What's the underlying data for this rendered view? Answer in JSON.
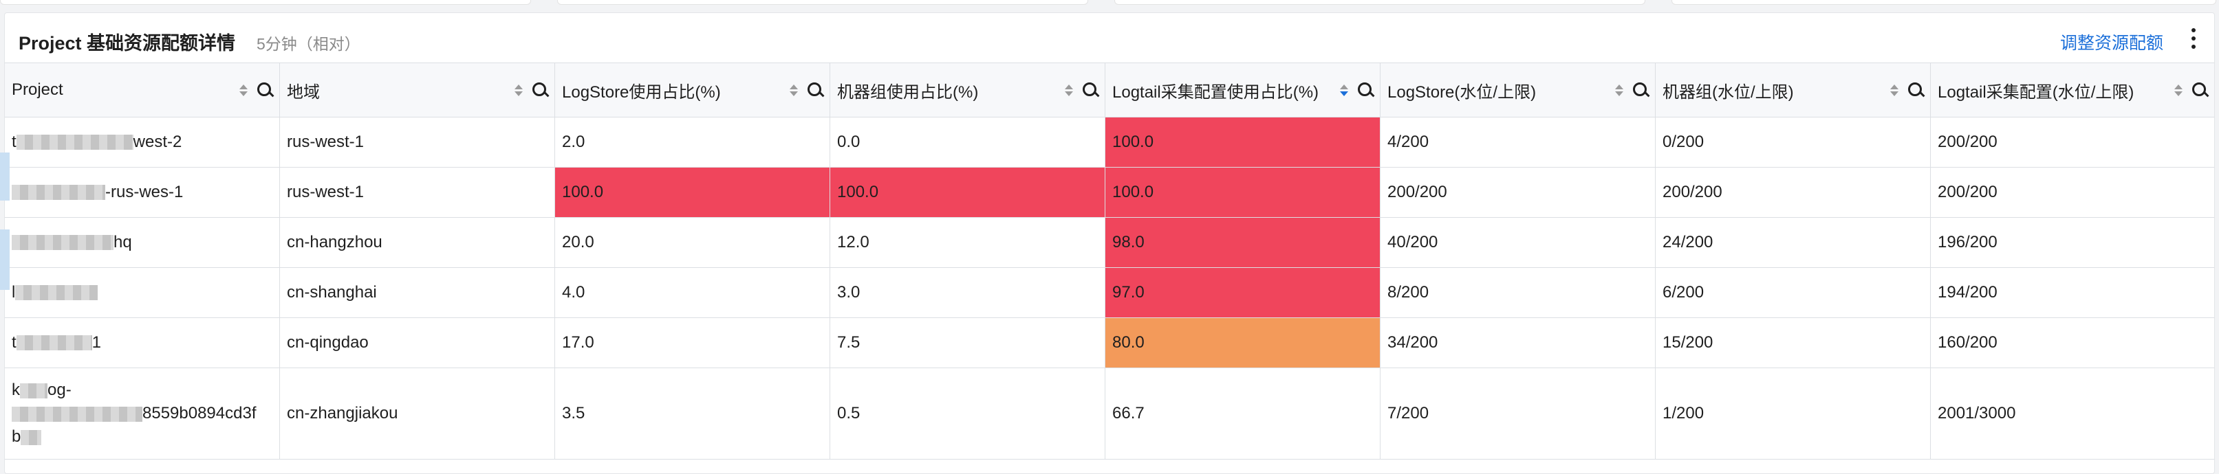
{
  "header": {
    "title": "Project 基础资源配额详情",
    "subtitle": "5分钟（相对）",
    "action": "调整资源配额"
  },
  "columns": [
    {
      "label": "Project",
      "sort_active": false
    },
    {
      "label": "地域",
      "sort_active": false
    },
    {
      "label": "LogStore使用占比(%)",
      "sort_active": false
    },
    {
      "label": "机器组使用占比(%)",
      "sort_active": false
    },
    {
      "label": "Logtail采集配置使用占比(%)",
      "sort_active": true
    },
    {
      "label": "LogStore(水位/上限)",
      "sort_active": false
    },
    {
      "label": "机器组(水位/上限)",
      "sort_active": false
    },
    {
      "label": "Logtail采集配置(水位/上限)",
      "sort_active": false
    }
  ],
  "rows": [
    {
      "project_prefix": "t",
      "project_suffix": "west-2",
      "region": "rus-west-1",
      "logstore_pct": "2.0",
      "machine_pct": "0.0",
      "logtail_pct": "100.0",
      "logstore_quota": "4/200",
      "machine_quota": "0/200",
      "logtail_quota": "200/200"
    },
    {
      "project_prefix": "",
      "project_suffix": "-rus-wes-1",
      "region": "rus-west-1",
      "logstore_pct": "100.0",
      "machine_pct": "100.0",
      "logtail_pct": "100.0",
      "logstore_quota": "200/200",
      "machine_quota": "200/200",
      "logtail_quota": "200/200"
    },
    {
      "project_prefix": "",
      "project_suffix": "hq",
      "region": "cn-hangzhou",
      "logstore_pct": "20.0",
      "machine_pct": "12.0",
      "logtail_pct": "98.0",
      "logstore_quota": "40/200",
      "machine_quota": "24/200",
      "logtail_quota": "196/200"
    },
    {
      "project_prefix": "l",
      "project_suffix": "",
      "region": "cn-shanghai",
      "logstore_pct": "4.0",
      "machine_pct": "3.0",
      "logtail_pct": "97.0",
      "logstore_quota": "8/200",
      "machine_quota": "6/200",
      "logtail_quota": "194/200"
    },
    {
      "project_prefix": "t",
      "project_suffix": "1",
      "region": "cn-qingdao",
      "logstore_pct": "17.0",
      "machine_pct": "7.5",
      "logtail_pct": "80.0",
      "logstore_quota": "34/200",
      "machine_quota": "15/200",
      "logtail_quota": "160/200"
    },
    {
      "project_line1": "k",
      "project_line1b": "og-",
      "project_line2": "8559b0894cd3f",
      "project_line3": "b",
      "region": "cn-zhangjiakou",
      "logstore_pct": "3.5",
      "machine_pct": "0.5",
      "logtail_pct": "66.7",
      "logstore_quota": "7/200",
      "machine_quota": "1/200",
      "logtail_quota": "2001/3000"
    }
  ],
  "colors": {
    "critical": "#f0455c",
    "warning": "#f39a5a",
    "link": "#1b6fd9"
  },
  "icons": [
    "sort-icon",
    "search-icon",
    "more-icon"
  ]
}
